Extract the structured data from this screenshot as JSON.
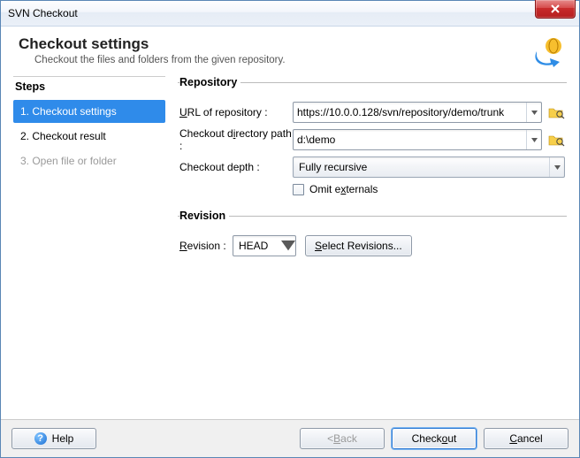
{
  "window": {
    "title": "SVN Checkout"
  },
  "header": {
    "title": "Checkout settings",
    "subtitle": "Checkout the files and folders from the given repository."
  },
  "steps": {
    "heading": "Steps",
    "s1": "1. Checkout settings",
    "s2": "2. Checkout result",
    "s3": "3. Open file or folder"
  },
  "repository": {
    "legend": "Repository",
    "url_label_pre": "",
    "url_label_u": "U",
    "url_label_post": "RL of repository :",
    "url_value": "https://10.0.0.128/svn/repository/demo/trunk",
    "dir_label_pre": "Checkout d",
    "dir_label_u": "i",
    "dir_label_post": "rectory path :",
    "dir_value": "d:\\demo",
    "depth_label": "Checkout depth :",
    "depth_value": "Fully recursive",
    "omit_pre": "Omit e",
    "omit_u": "x",
    "omit_post": "ternals"
  },
  "revision": {
    "legend": "Revision",
    "label_u": "R",
    "label_post": "evision :",
    "value": "HEAD",
    "select_u": "S",
    "select_post": "elect Revisions..."
  },
  "footer": {
    "help": "Help",
    "back_pre": "< ",
    "back_u": "B",
    "back_post": "ack",
    "checkout_pre": "Check",
    "checkout_u": "o",
    "checkout_post": "ut",
    "cancel_u": "C",
    "cancel_post": "ancel"
  }
}
